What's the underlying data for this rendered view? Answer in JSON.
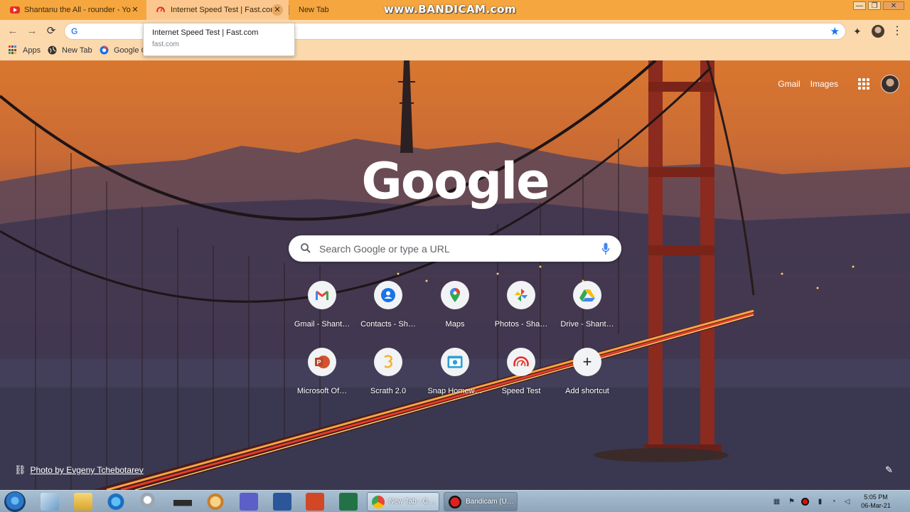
{
  "tabs": [
    {
      "title": "Shantanu the All - rounder - You",
      "icon": "youtube-icon",
      "close": "✕"
    },
    {
      "title": "Internet Speed Test | Fast.com",
      "icon": "fast-speedometer-icon",
      "close": "✕"
    },
    {
      "title": "New Tab"
    }
  ],
  "watermark": "www.BANDICAM.com",
  "window_controls": {
    "minimize": "—",
    "restore": "❐",
    "close": "✕"
  },
  "toolbar": {
    "back": "←",
    "forward": "→",
    "reload": "⟳",
    "omnibox_icon": "G",
    "bookmark_star": "★",
    "extensions": "✦",
    "menu": "⋮"
  },
  "bookmarks": [
    {
      "label": "Apps",
      "icon": "apps-grid-icon"
    },
    {
      "label": "New Tab",
      "icon": "globe-icon"
    },
    {
      "label": "Google C",
      "icon": "chrome-icon"
    }
  ],
  "tooltip": {
    "title": "Internet Speed Test | Fast.com",
    "url": "fast.com"
  },
  "ntp": {
    "top_links": {
      "gmail": "Gmail",
      "images": "Images"
    },
    "logo": "Google",
    "search_placeholder": "Search Google or type a URL",
    "shortcuts": [
      {
        "label": "Gmail - Shant…",
        "icon": "gmail-icon"
      },
      {
        "label": "Contacts - Sh…",
        "icon": "contacts-icon"
      },
      {
        "label": "Maps",
        "icon": "maps-icon"
      },
      {
        "label": "Photos - Sha…",
        "icon": "photos-icon"
      },
      {
        "label": "Drive - Shant…",
        "icon": "drive-icon"
      },
      {
        "label": "Microsoft Of…",
        "icon": "microsoft-office-icon"
      },
      {
        "label": "Scrath 2.0",
        "icon": "scratch-icon"
      },
      {
        "label": "Snap Homew…",
        "icon": "camera-icon"
      },
      {
        "label": "Speed Test",
        "icon": "speedometer-icon"
      },
      {
        "label": "Add shortcut",
        "icon": "plus-icon",
        "glyph": "+"
      }
    ],
    "photo_credit": "Photo by Evgeny Tchebotarev",
    "customize_glyph": "✎"
  },
  "taskbar": {
    "tasks": [
      {
        "label": "New Tab - G…",
        "icon": "chrome-icon"
      },
      {
        "label": "Bandicam (U…",
        "icon": "bandicam-record-icon"
      }
    ],
    "clock": {
      "time": "5:05 PM",
      "date": "06-Mar-21"
    }
  },
  "colors": {
    "tabstrip": "#f6a63e",
    "toolbar": "#fcd9ad",
    "accent_blue": "#1a73e8"
  }
}
